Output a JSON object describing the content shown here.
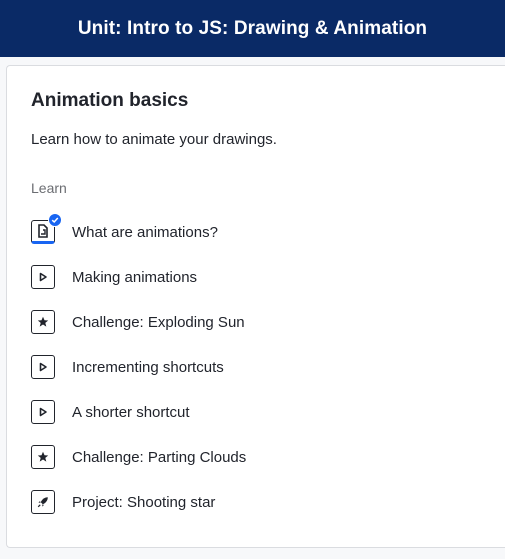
{
  "header": {
    "title": "Unit: Intro to JS: Drawing & Animation"
  },
  "lesson": {
    "title": "Animation basics",
    "description": "Learn how to animate your drawings.",
    "section_label": "Learn",
    "items": [
      {
        "label": "What are animations?",
        "type": "article",
        "icon": "article-icon",
        "completed": true
      },
      {
        "label": "Making animations",
        "type": "video",
        "icon": "play-icon",
        "completed": false
      },
      {
        "label": "Challenge: Exploding Sun",
        "type": "challenge",
        "icon": "star-icon",
        "completed": false
      },
      {
        "label": "Incrementing shortcuts",
        "type": "video",
        "icon": "play-icon",
        "completed": false
      },
      {
        "label": "A shorter shortcut",
        "type": "video",
        "icon": "play-icon",
        "completed": false
      },
      {
        "label": "Challenge: Parting Clouds",
        "type": "challenge",
        "icon": "star-icon",
        "completed": false
      },
      {
        "label": "Project: Shooting star",
        "type": "project",
        "icon": "rocket-icon",
        "completed": false
      }
    ]
  },
  "colors": {
    "header_bg": "#0a2a66",
    "accent": "#1865f2",
    "text": "#21242c",
    "muted": "#6b6d72"
  }
}
